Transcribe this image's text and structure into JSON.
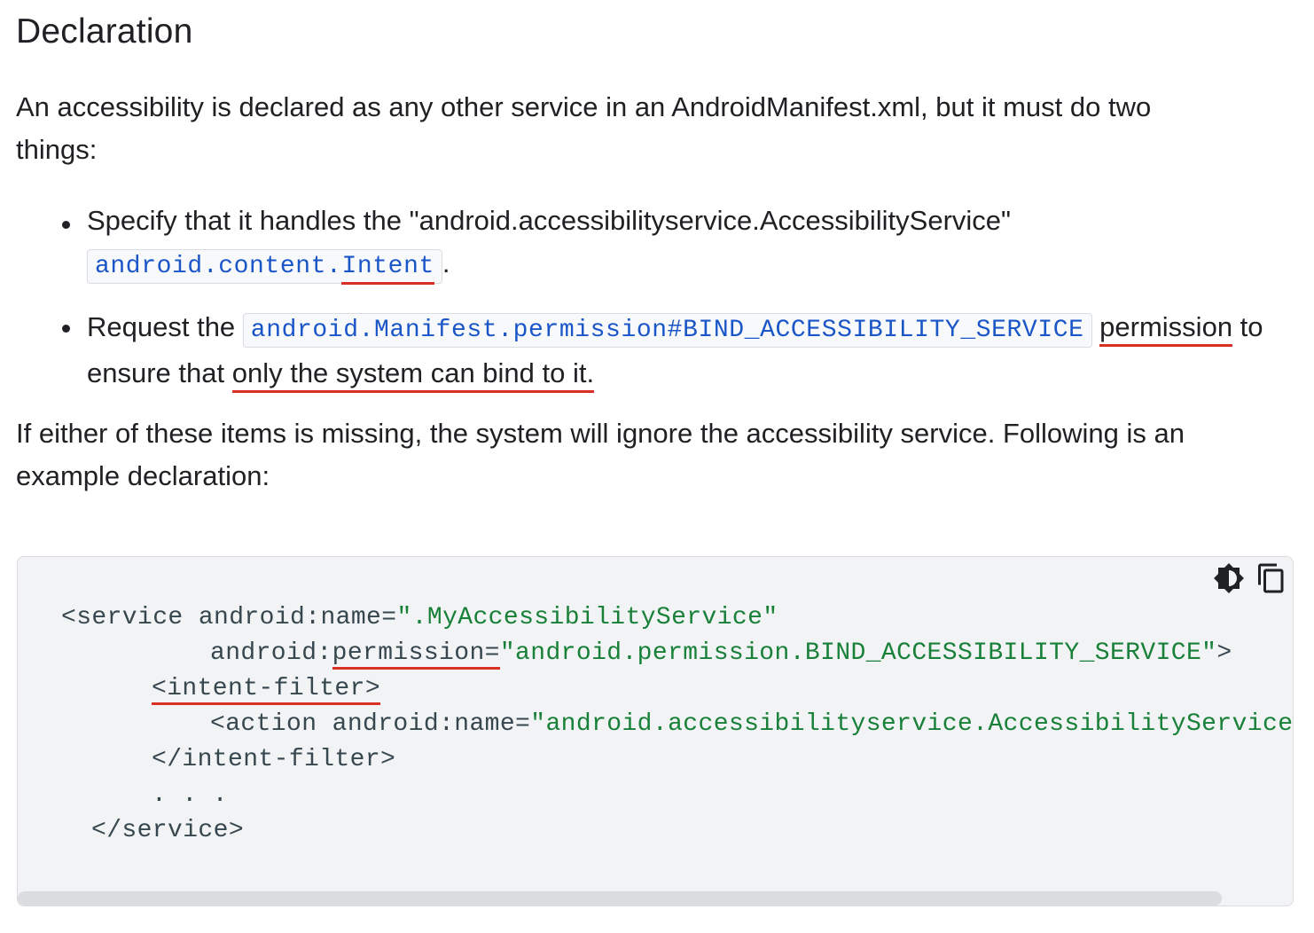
{
  "heading": "Declaration",
  "intro": {
    "line1": "An accessibility is declared as any other service in an AndroidManifest.xml, but it must do two",
    "line2": "things:"
  },
  "bullets": [
    {
      "text_before": "Specify that it handles the \"android.accessibilityservice.AccessibilityService\"",
      "code_part1": "android.content.",
      "code_part2": "Intent",
      "text_after": "."
    },
    {
      "text_before": "Request the",
      "code": "android.Manifest.permission#BIND_ACCESSIBILITY_SERVICE",
      "text_mid": "permission",
      "text_to": " to",
      "line2_before": "ensure that ",
      "line2_underlined": "only the system can bind to it."
    }
  ],
  "outro": {
    "line1": "If either of these items is missing, the system will ignore the accessibility service. Following is an",
    "line2": "example declaration:"
  },
  "code_block": {
    "line1_tag": "<service android:name=",
    "line1_str": "\".MyAccessibilityService\"",
    "line2_attr_prefix": "android:",
    "line2_attr": "permission",
    "line2_eq": "=",
    "line2_str": "\"android.permission.BIND_ACCESSIBILITY_SERVICE\"",
    "line2_close": ">",
    "line3": "<intent-filter>",
    "line4_tag": "<action android:name=",
    "line4_str": "\"android.accessibilityservice.AccessibilityService\"",
    "line5": "</intent-filter>",
    "line6": ". . .",
    "line7": "</service>"
  },
  "toolbar": {
    "theme_icon": "brightness-icon",
    "copy_icon": "copy-icon"
  },
  "colors": {
    "accent_underline": "#d93025",
    "code_link": "#1a56c8",
    "code_string": "#188038"
  }
}
